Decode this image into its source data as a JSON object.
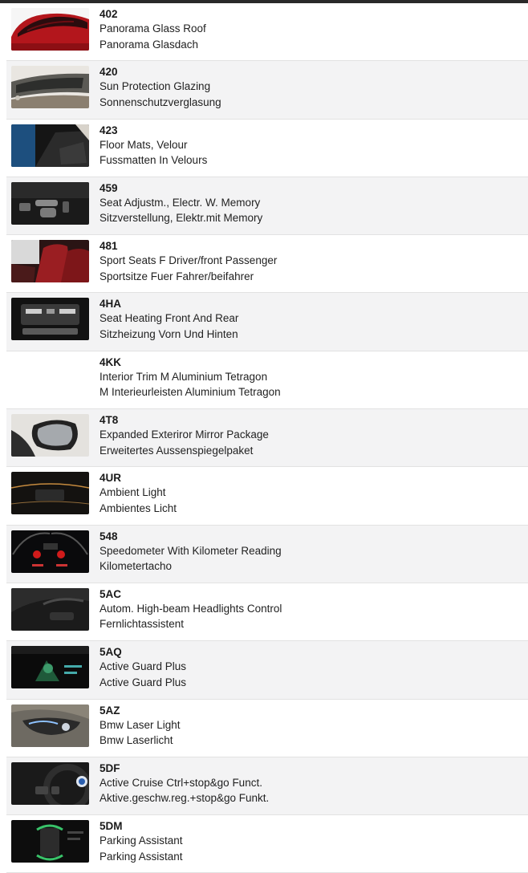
{
  "options": [
    {
      "code": "402",
      "en": "Panorama Glass Roof",
      "de": "Panorama Glasdach",
      "thumb": "red-car-roof-thumbnail"
    },
    {
      "code": "420",
      "en": "Sun Protection Glazing",
      "de": "Sonnenschutzverglasung",
      "thumb": "side-window-thumbnail"
    },
    {
      "code": "423",
      "en": "Floor Mats, Velour",
      "de": "Fussmatten In Velours",
      "thumb": "floor-mats-thumbnail"
    },
    {
      "code": "459",
      "en": "Seat Adjustm., Electr. W. Memory",
      "de": "Sitzverstellung, Elektr.mit Memory",
      "thumb": "seat-controls-thumbnail"
    },
    {
      "code": "481",
      "en": "Sport Seats F Driver/front Passenger",
      "de": "Sportsitze Fuer Fahrer/beifahrer",
      "thumb": "red-sport-seats-thumbnail"
    },
    {
      "code": "4HA",
      "en": "Seat Heating Front And Rear",
      "de": "Sitzheizung Vorn Und Hinten",
      "thumb": "climate-panel-thumbnail"
    },
    {
      "code": "4KK",
      "en": "Interior Trim M Aluminium Tetragon",
      "de": "M Interieurleisten Aluminium Tetragon",
      "thumb": ""
    },
    {
      "code": "4T8",
      "en": "Expanded Exteriror Mirror Package",
      "de": "Erweitertes Aussenspiegelpaket",
      "thumb": "side-mirror-thumbnail"
    },
    {
      "code": "4UR",
      "en": "Ambient Light",
      "de": "Ambientes Licht",
      "thumb": "ambient-light-thumbnail"
    },
    {
      "code": "548",
      "en": "Speedometer With Kilometer Reading",
      "de": "Kilometertacho",
      "thumb": "speedometer-thumbnail"
    },
    {
      "code": "5AC",
      "en": "Autom. High-beam Headlights Control",
      "de": "Fernlichtassistent",
      "thumb": "dashboard-thumbnail"
    },
    {
      "code": "5AQ",
      "en": "Active Guard Plus",
      "de": "Active Guard Plus",
      "thumb": "active-guard-thumbnail"
    },
    {
      "code": "5AZ",
      "en": "Bmw Laser Light",
      "de": "Bmw Laserlicht",
      "thumb": "laser-headlight-thumbnail"
    },
    {
      "code": "5DF",
      "en": "Active Cruise Ctrl+stop&go Funct.",
      "de": "Aktive.geschw.reg.+stop&go Funkt.",
      "thumb": "steering-wheel-thumbnail"
    },
    {
      "code": "5DM",
      "en": "Parking Assistant",
      "de": "Parking Assistant",
      "thumb": "parking-assistant-thumbnail"
    }
  ]
}
